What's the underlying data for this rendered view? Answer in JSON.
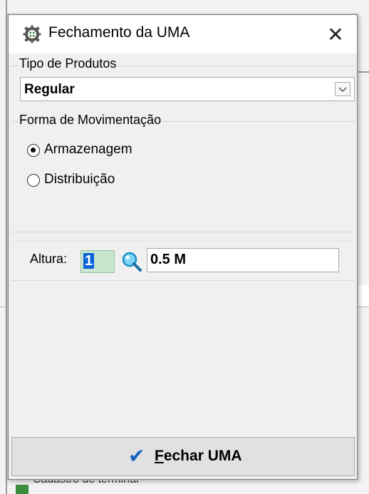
{
  "background": {
    "footer_item": "Cadastro de terminal"
  },
  "dialog": {
    "title": "Fechamento da UMA",
    "close_label": "✕",
    "tipo_produtos": {
      "label": "Tipo de Produtos",
      "selected": "Regular"
    },
    "forma_movimentacao": {
      "label": "Forma de Movimentação",
      "options": [
        {
          "label": "Armazenagem",
          "selected": true
        },
        {
          "label": "Distribuição",
          "selected": false
        }
      ]
    },
    "altura": {
      "label": "Altura:",
      "code": "1",
      "description": "0.5 M"
    },
    "fechar_button": {
      "mnemonic": "F",
      "rest": "echar UMA"
    }
  },
  "colors": {
    "accent": "#0a64d8",
    "code_field_bg": "#c9e7cf",
    "check_icon": "#1565c0"
  }
}
